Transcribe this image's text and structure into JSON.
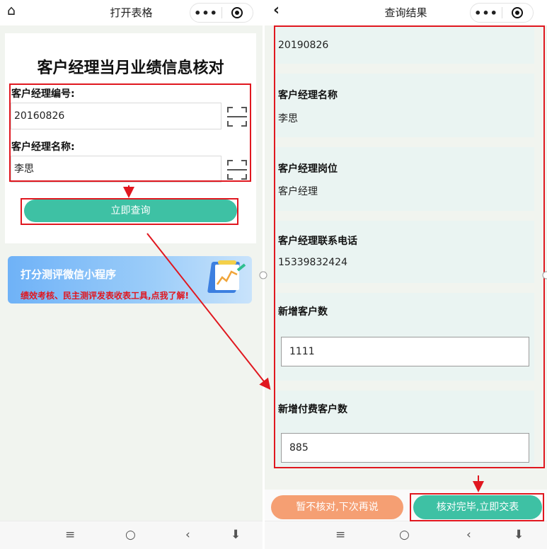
{
  "left": {
    "topbar": {
      "title": "打开表格"
    },
    "card": {
      "title": "客户经理当月业绩信息核对",
      "field1": {
        "label": "客户经理编号:",
        "value": "20160826"
      },
      "field2": {
        "label": "客户经理名称:",
        "value": "李思"
      },
      "query_button": "立即查询"
    },
    "banner": {
      "title": "打分测评微信小程序",
      "subtitle": "绩效考核、民主测评发表收表工具,点我了解!"
    }
  },
  "right": {
    "topbar": {
      "title": "查询结果"
    },
    "top_value": "20190826",
    "fields": [
      {
        "label": "客户经理名称",
        "value": "李思"
      },
      {
        "label": "客户经理岗位",
        "value": "客户经理"
      },
      {
        "label": "客户经理联系电话",
        "value": "15339832424"
      },
      {
        "label": "新增客户数",
        "value": "1111"
      },
      {
        "label": "新增付费客户数",
        "value": "885"
      }
    ],
    "buttons": {
      "later": "暂不核对,下次再说",
      "submit": "核对完毕,立即交表"
    }
  },
  "icons": {
    "home": "home-icon",
    "back": "back-icon",
    "more": "more-icon",
    "target": "target-icon",
    "scan": "scan-icon"
  },
  "colors": {
    "accent": "#3ec1a4",
    "highlight": "#e0171f",
    "later_button": "#f59f73",
    "banner": "#6fb2f7"
  }
}
